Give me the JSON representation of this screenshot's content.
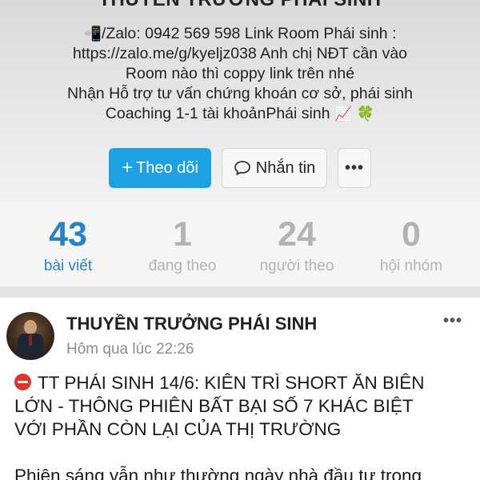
{
  "profile": {
    "name": "THUYỀN TRƯỞNG PHÁI SINH",
    "bio": {
      "line1_text": "/Zalo: 0942 569 598 Link Room Phái sinh :",
      "line2": "https://zalo.me/g/kyeljz038 Anh chị NĐT cần vào",
      "line3": "Room nào thì coppy link trên nhé",
      "line4": "Nhận Hỗ trợ tư vấn chứng khoán cơ sở, phái sinh",
      "line5_text": "Coaching 1-1 tài khoảnPhái sinh"
    }
  },
  "icons": {
    "phone": "mobile-phone-arrow-icon",
    "chart": "chart-increasing-icon",
    "clover": "four-leaf-clover-icon"
  },
  "actions": {
    "follow_label": "Theo dõi",
    "follow_plus": "+",
    "message_label": "Nhắn tin",
    "more_label": "•••"
  },
  "stats": [
    {
      "value": "43",
      "label": "bài viết"
    },
    {
      "value": "1",
      "label": "đang theo"
    },
    {
      "value": "24",
      "label": "người theo"
    },
    {
      "value": "0",
      "label": "hội nhóm"
    }
  ],
  "post": {
    "author": "THUYỀN TRƯỞNG PHÁI SINH",
    "time": "Hôm qua lúc 22:26",
    "more_label": "•••",
    "lines": [
      "TT PHÁI SINH 14/6: KIÊN TRÌ SHORT ĂN BIÊN",
      "LỚN - THÔNG  PHIÊN BẤT BẠI SỐ 7 KHÁC BIỆT",
      "VỚI PHẦN CÒN LẠI CỦA THỊ TRƯỜNG",
      "Phiên sáng vẫn như thường ngày nhà đầu tư trong"
    ]
  },
  "colors": {
    "accent": "#1da1e2",
    "stat_active": "#2782c8",
    "stat_inactive": "#b3b3b3",
    "stop_icon": "#e0342f"
  }
}
